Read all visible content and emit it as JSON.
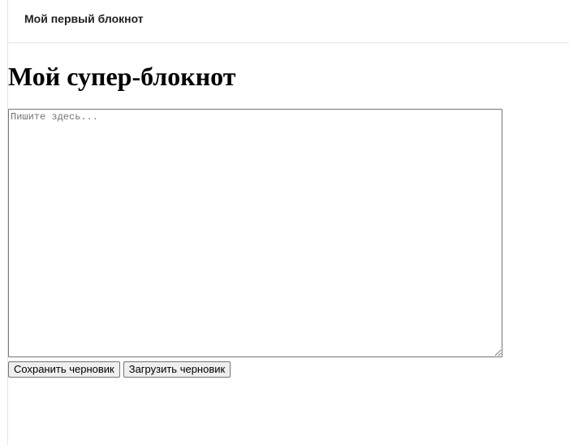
{
  "tab": {
    "title": "Мой первый блокнот"
  },
  "page": {
    "heading": "Мой супер-блокнот"
  },
  "editor": {
    "placeholder": "Пишите здесь...",
    "value": ""
  },
  "actions": {
    "save_label": "Сохранить черновик",
    "load_label": "Загрузить черновик"
  }
}
